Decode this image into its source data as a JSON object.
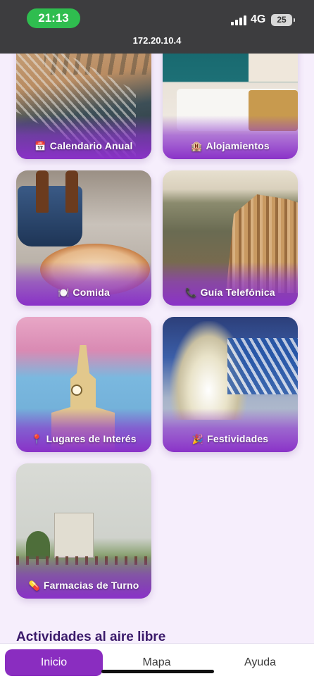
{
  "status_bar": {
    "time": "21:13",
    "network": "4G",
    "battery": "25"
  },
  "browser": {
    "url": "172.20.10.4"
  },
  "cards": [
    {
      "label": "Calendario Anual",
      "icon": "📅",
      "icon_name": "calendar-icon"
    },
    {
      "label": "Alojamientos",
      "icon": "🏨",
      "icon_name": "hotel-icon"
    },
    {
      "label": "Comida",
      "icon": "🍽️",
      "icon_name": "plate-icon"
    },
    {
      "label": "Guía Telefónica",
      "icon": "📞",
      "icon_name": "phone-icon"
    },
    {
      "label": "Lugares de Interés",
      "icon": "📍",
      "icon_name": "pin-icon"
    },
    {
      "label": "Festividades",
      "icon": "🎉",
      "icon_name": "party-icon"
    },
    {
      "label": "Farmacias de Turno",
      "icon": "💊",
      "icon_name": "pill-icon"
    }
  ],
  "section": {
    "title": "Actividades al aire libre"
  },
  "nav": {
    "tabs": [
      {
        "label": "Inicio",
        "active": true
      },
      {
        "label": "Mapa",
        "active": false
      },
      {
        "label": "Ayuda",
        "active": false
      }
    ]
  },
  "colors": {
    "accent": "#8a2dc0",
    "background": "#f6eefc",
    "section_title": "#3b1a6b",
    "status_bar": "#3d3d3f",
    "time_pill": "#2fbd4f"
  }
}
